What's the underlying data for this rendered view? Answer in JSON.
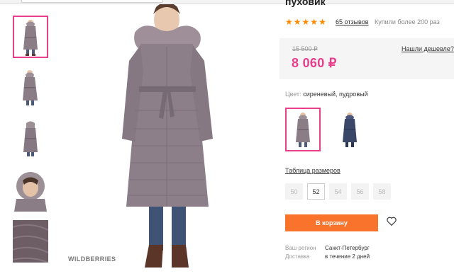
{
  "product": {
    "title": "пуховик",
    "rating_stars": 5,
    "reviews": "65 отзывов",
    "bought": "Купили более 200 раз"
  },
  "price": {
    "old": "15 500 ₽",
    "current": "8 060 ₽",
    "cheaper_link": "Нашли дешевле?"
  },
  "color": {
    "label": "Цвет:",
    "value": "сиреневый, пудровый"
  },
  "sizes": {
    "table_link": "Таблица размеров",
    "options": [
      "50",
      "52",
      "54",
      "56",
      "58"
    ],
    "selected": "52"
  },
  "cart": {
    "button": "В корзину"
  },
  "delivery": {
    "region_label": "Ваш регион",
    "region_value": "Санкт-Петербург",
    "delivery_label": "Доставка",
    "delivery_value": "в течение 2 дней"
  },
  "gallery": {
    "watermark": "WILDBERRIES"
  },
  "colors": {
    "accent_pink": "#e83e8c",
    "orange": "#f9732d",
    "coat": "#8a7d86",
    "coat_navy": "#3b4766"
  }
}
